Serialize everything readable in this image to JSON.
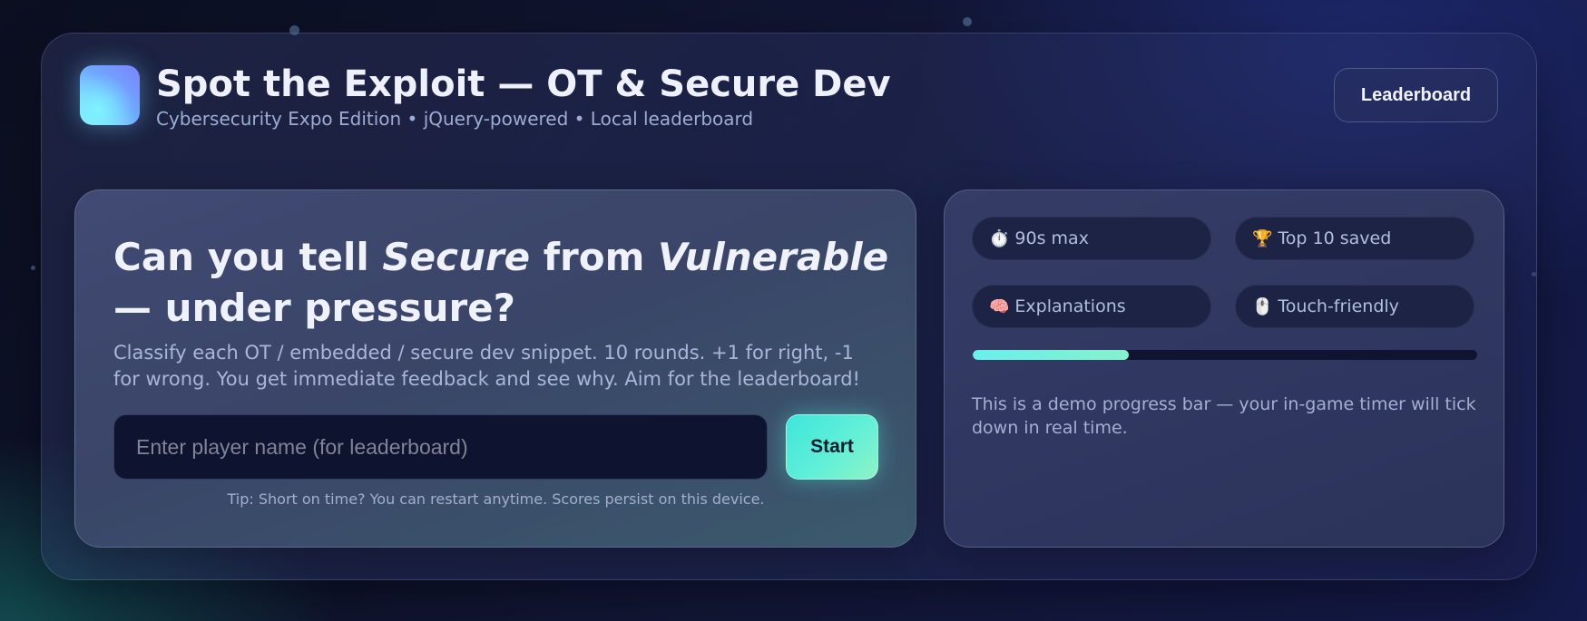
{
  "header": {
    "title": "Spot the Exploit — OT & Secure Dev",
    "subtitle": "Cybersecurity Expo Edition • jQuery-powered • Local leaderboard",
    "leaderboard_label": "Leaderboard"
  },
  "hero": {
    "headline_part1": "Can you tell ",
    "headline_em1": "Secure",
    "headline_part2": " from ",
    "headline_em2": "Vulnerable",
    "headline_part3": " — under pressure?",
    "description": "Classify each OT / embedded / secure dev snippet. 10 rounds. +1 for right, -1 for wrong. You get immediate feedback and see why. Aim for the leaderboard!",
    "name_placeholder": "Enter player name (for leaderboard)",
    "name_value": "",
    "start_label": "Start",
    "tip": "Tip: Short on time? You can restart anytime. Scores persist on this device."
  },
  "side": {
    "chips": [
      {
        "icon": "stopwatch-icon",
        "glyph": "⏱️",
        "label": "90s max"
      },
      {
        "icon": "trophy-icon",
        "glyph": "🏆",
        "label": "Top 10 saved"
      },
      {
        "icon": "brain-icon",
        "glyph": "🧠",
        "label": "Explanations"
      },
      {
        "icon": "mouse-icon",
        "glyph": "🖱️",
        "label": "Touch-friendly"
      }
    ],
    "progress_fraction": 0.31,
    "note": "This is a demo progress bar — your in-game timer will tick down in real time."
  },
  "colors": {
    "accent_teal": "#3ee6dc",
    "accent_mint": "#8ef3c6",
    "background_dark": "#0b0f20",
    "text_primary": "#eef0fb",
    "text_muted": "#9eabd3"
  }
}
